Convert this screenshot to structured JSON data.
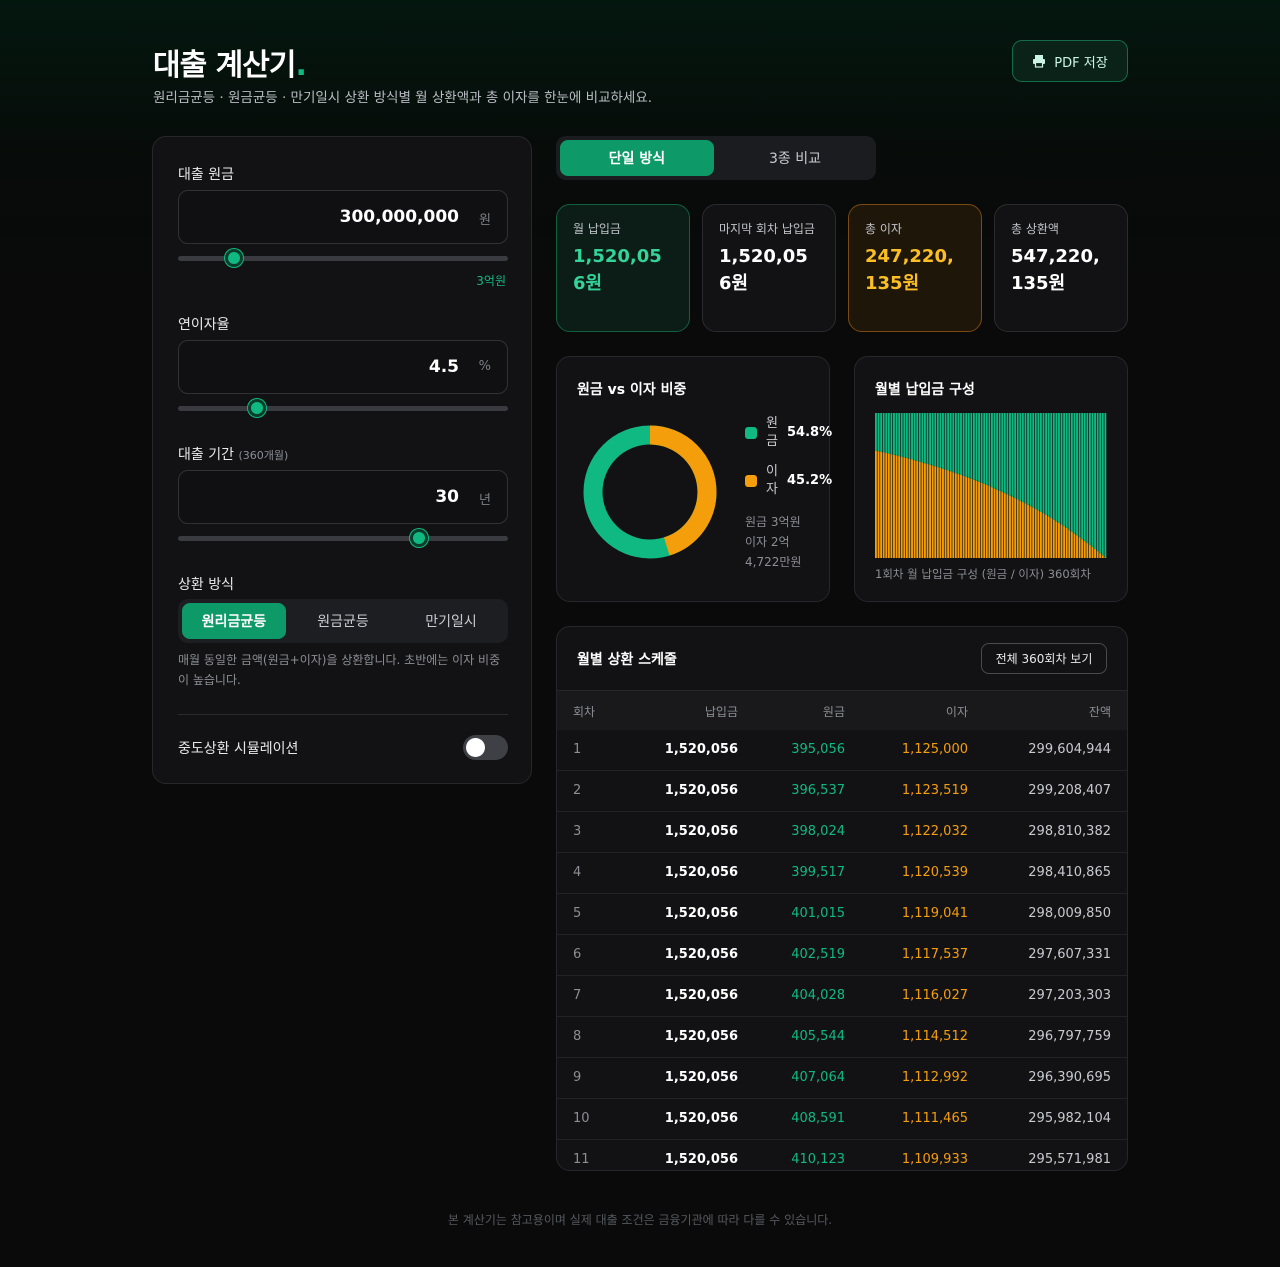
{
  "header": {
    "title": "대출 계산기",
    "title_dot": ".",
    "subtitle": "원리금균등 · 원금균등 · 만기일시 상환 방식별 월 상환액과 총 이자를 한눈에 비교하세요.",
    "pdf_button": "PDF 저장"
  },
  "form": {
    "principal": {
      "label": "대출 원금",
      "value": "300,000,000",
      "unit": "원",
      "hint": "3억원",
      "slider_fraction": 0.17
    },
    "rate": {
      "label": "연이자율",
      "value": "4.5",
      "unit": "%",
      "slider_fraction": 0.24
    },
    "term": {
      "label": "대출 기간",
      "sub": "(360개월)",
      "value": "30",
      "unit": "년",
      "slider_fraction": 0.73
    },
    "method": {
      "label": "상환 방식",
      "options": [
        "원리금균등",
        "원금균등",
        "만기일시"
      ],
      "selected": "원리금균등",
      "description": "매월 동일한 금액(원금+이자)을 상환합니다. 초반에는 이자 비중이 높습니다."
    },
    "prepay_toggle": {
      "label": "중도상환 시뮬레이션",
      "on": false
    }
  },
  "tabs": {
    "single": "단일 방식",
    "compare": "3종 비교",
    "active": "single"
  },
  "summary": {
    "monthly": {
      "label": "월 납입금",
      "value": "1,520,056원"
    },
    "last": {
      "label": "마지막 회차 납입금",
      "value": "1,520,056원"
    },
    "interest": {
      "label": "총 이자",
      "value": "247,220,135원"
    },
    "total": {
      "label": "총 상환액",
      "value": "547,220,135원"
    }
  },
  "colors": {
    "principal": "#10b981",
    "interest": "#f59e0b",
    "accent": "#0e9a68"
  },
  "ratio_chart": {
    "title": "원금 vs 이자 비중",
    "principal_label": "원금",
    "interest_label": "이자",
    "principal_pct": "54.8%",
    "interest_pct": "45.2%",
    "principal_note": "원금 3억원",
    "interest_note": "이자 2억 4,722만원"
  },
  "chart_data": {
    "type": "area",
    "title": "월별 납입금 구성",
    "caption": "1회차 월 납입금 구성 (원금 / 이자) 360회차",
    "x_range": [
      1,
      360
    ],
    "payment": 1520056,
    "principal": 300000000,
    "annual_rate": 4.5,
    "series": [
      {
        "name": "원금",
        "color": "#10b981",
        "first": 395056,
        "last": 1514380
      },
      {
        "name": "이자",
        "color": "#f59e0b",
        "first": 1125000,
        "last": 5676
      }
    ]
  },
  "schedule": {
    "title": "월별 상환 스케줄",
    "view_all": "전체 360회차 보기",
    "columns": [
      "회차",
      "납입금",
      "원금",
      "이자",
      "잔액"
    ],
    "rows": [
      [
        "1",
        "1,520,056",
        "395,056",
        "1,125,000",
        "299,604,944"
      ],
      [
        "2",
        "1,520,056",
        "396,537",
        "1,123,519",
        "299,208,407"
      ],
      [
        "3",
        "1,520,056",
        "398,024",
        "1,122,032",
        "298,810,382"
      ],
      [
        "4",
        "1,520,056",
        "399,517",
        "1,120,539",
        "298,410,865"
      ],
      [
        "5",
        "1,520,056",
        "401,015",
        "1,119,041",
        "298,009,850"
      ],
      [
        "6",
        "1,520,056",
        "402,519",
        "1,117,537",
        "297,607,331"
      ],
      [
        "7",
        "1,520,056",
        "404,028",
        "1,116,027",
        "297,203,303"
      ],
      [
        "8",
        "1,520,056",
        "405,544",
        "1,114,512",
        "296,797,759"
      ],
      [
        "9",
        "1,520,056",
        "407,064",
        "1,112,992",
        "296,390,695"
      ],
      [
        "10",
        "1,520,056",
        "408,591",
        "1,111,465",
        "295,982,104"
      ],
      [
        "11",
        "1,520,056",
        "410,123",
        "1,109,933",
        "295,571,981"
      ]
    ]
  },
  "footer": "본 계산기는 참고용이며 실제 대출 조건은 금융기관에 따라 다를 수 있습니다."
}
